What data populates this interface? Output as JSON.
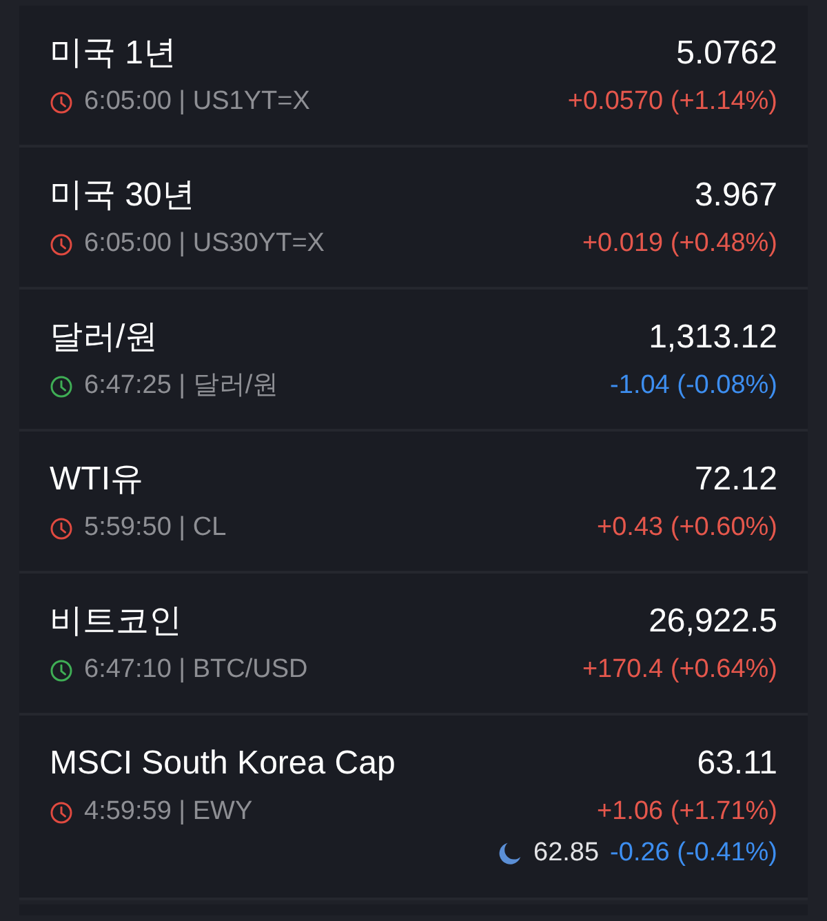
{
  "quotes": [
    {
      "name": "미국 1년",
      "price": "5.0762",
      "market_open": false,
      "info": "6:05:00 | US1YT=X",
      "change": "+0.0570 (+1.14%)",
      "color": "#e5574c"
    },
    {
      "name": "미국 30년",
      "price": "3.967",
      "market_open": false,
      "info": "6:05:00 | US30YT=X",
      "change": "+0.019 (+0.48%)",
      "color": "#e5574c"
    },
    {
      "name": "달러/원",
      "price": "1,313.12",
      "market_open": true,
      "info": "6:47:25 | 달러/원",
      "change": "-1.04 (-0.08%)",
      "color": "#3d8ef0"
    },
    {
      "name": "WTI유",
      "price": "72.12",
      "market_open": false,
      "info": "5:59:50 | CL",
      "change": "+0.43 (+0.60%)",
      "color": "#e5574c"
    },
    {
      "name": "비트코인",
      "price": "26,922.5",
      "market_open": true,
      "info": "6:47:10 | BTC/USD",
      "change": "+170.4 (+0.64%)",
      "color": "#e5574c"
    },
    {
      "name": "MSCI South Korea Cap",
      "price": "63.11",
      "market_open": false,
      "info": "4:59:59 | EWY",
      "change": "+1.06 (+1.71%)",
      "color": "#e5574c",
      "after_hours": {
        "price": "62.85",
        "change": "-0.26 (-0.41%)",
        "color": "#3d8ef0"
      }
    }
  ]
}
